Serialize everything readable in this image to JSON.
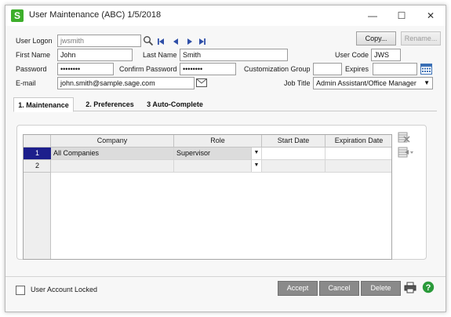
{
  "window": {
    "title": "User Maintenance (ABC) 1/5/2018",
    "minimize_glyph": "—",
    "maximize_glyph": "☐",
    "close_glyph": "✕"
  },
  "form": {
    "user_logon_label": "User Logon",
    "user_logon_value": "jwsmith",
    "copy_button": "Copy...",
    "rename_button": "Rename...",
    "first_name_label": "First Name",
    "first_name_value": "John",
    "last_name_label": "Last Name",
    "last_name_value": "Smith",
    "user_code_label": "User Code",
    "user_code_value": "JWS",
    "password_label": "Password",
    "password_value": "••••••••",
    "confirm_password_label": "Confirm Password",
    "confirm_password_value": "••••••••",
    "customization_group_label": "Customization Group",
    "customization_group_value": "",
    "expires_label": "Expires",
    "expires_value": "",
    "email_label": "E-mail",
    "email_value": "john.smith@sample.sage.com",
    "job_title_label": "Job Title",
    "job_title_value": "Admin Assistant/Office Manager"
  },
  "tabs": [
    {
      "label": "1. Maintenance"
    },
    {
      "label": "2. Preferences"
    },
    {
      "label": "3 Auto-Complete"
    }
  ],
  "grid": {
    "headers": [
      "Company",
      "Role",
      "Start Date",
      "Expiration Date"
    ],
    "rows": [
      {
        "num": "1",
        "company": "All Companies",
        "role": "Supervisor",
        "start": "",
        "expiration": ""
      },
      {
        "num": "2",
        "company": "",
        "role": "",
        "start": "",
        "expiration": ""
      }
    ]
  },
  "footer": {
    "account_locked_label": "User Account Locked",
    "accept_button": "Accept",
    "cancel_button": "Cancel",
    "delete_button": "Delete"
  },
  "colors": {
    "app_icon": "#3dae2b",
    "active_row": "#1d1f8c",
    "nav_arrows": "#2f4fa8",
    "help_icon": "#2a9a3a"
  }
}
